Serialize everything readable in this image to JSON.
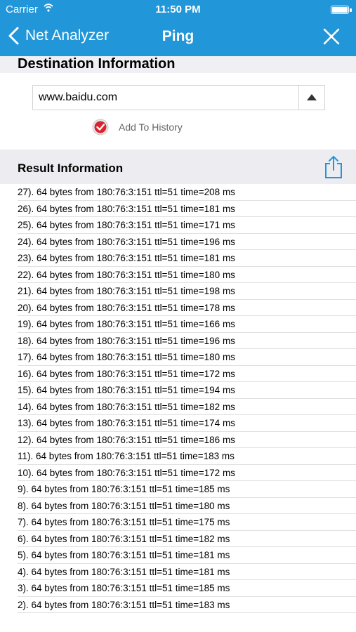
{
  "status_bar": {
    "carrier": "Carrier",
    "time": "11:50 PM"
  },
  "nav": {
    "back_label": "Net Analyzer",
    "title": "Ping"
  },
  "destination": {
    "header": "Destination Information",
    "host_value": "www.baidu.com",
    "add_to_history_label": "Add To History",
    "add_to_history_checked": true
  },
  "result": {
    "header": "Result Information",
    "lines": [
      "27). 64 bytes from 180:76:3:151 ttl=51 time=208 ms",
      "26). 64 bytes from 180:76:3:151 ttl=51 time=181 ms",
      "25). 64 bytes from 180:76:3:151 ttl=51 time=171 ms",
      "24). 64 bytes from 180:76:3:151 ttl=51 time=196 ms",
      "23). 64 bytes from 180:76:3:151 ttl=51 time=181 ms",
      "22). 64 bytes from 180:76:3:151 ttl=51 time=180 ms",
      "21). 64 bytes from 180:76:3:151 ttl=51 time=198 ms",
      "20). 64 bytes from 180:76:3:151 ttl=51 time=178 ms",
      "19). 64 bytes from 180:76:3:151 ttl=51 time=166 ms",
      "18). 64 bytes from 180:76:3:151 ttl=51 time=196 ms",
      "17). 64 bytes from 180:76:3:151 ttl=51 time=180 ms",
      "16). 64 bytes from 180:76:3:151 ttl=51 time=172 ms",
      "15). 64 bytes from 180:76:3:151 ttl=51 time=194 ms",
      "14). 64 bytes from 180:76:3:151 ttl=51 time=182 ms",
      "13). 64 bytes from 180:76:3:151 ttl=51 time=174 ms",
      "12). 64 bytes from 180:76:3:151 ttl=51 time=186 ms",
      "11). 64 bytes from 180:76:3:151 ttl=51 time=183 ms",
      "10). 64 bytes from 180:76:3:151 ttl=51 time=172 ms",
      "9). 64 bytes from 180:76:3:151 ttl=51 time=185 ms",
      "8). 64 bytes from 180:76:3:151 ttl=51 time=180 ms",
      "7). 64 bytes from 180:76:3:151 ttl=51 time=175 ms",
      "6). 64 bytes from 180:76:3:151 ttl=51 time=182 ms",
      "5). 64 bytes from 180:76:3:151 ttl=51 time=181 ms",
      "4). 64 bytes from 180:76:3:151 ttl=51 time=181 ms",
      "3). 64 bytes from 180:76:3:151 ttl=51 time=185 ms",
      "2). 64 bytes from 180:76:3:151 ttl=51 time=183 ms"
    ]
  },
  "icons": {
    "back": "chevron-left-icon",
    "close": "close-icon",
    "dropdown": "triangle-up-icon",
    "check": "check-circle-icon",
    "share": "share-icon",
    "wifi": "wifi-icon",
    "battery": "battery-icon"
  },
  "colors": {
    "accent": "#2196d8",
    "check": "#d9232e"
  }
}
